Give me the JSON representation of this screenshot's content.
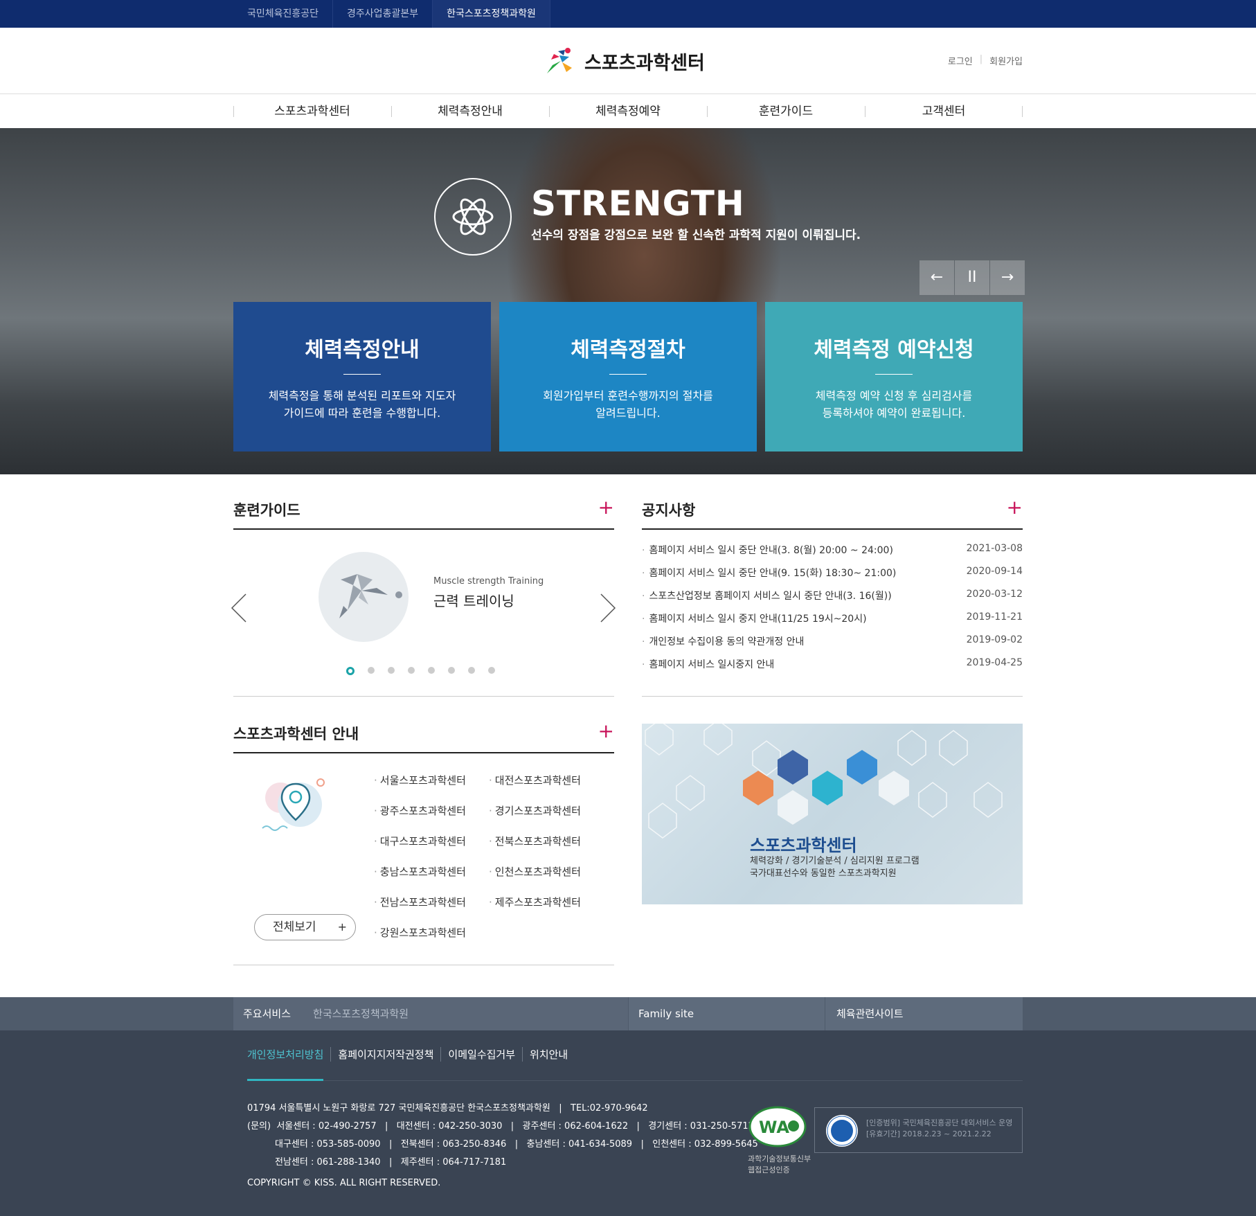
{
  "topbar": {
    "tabs": [
      "국민체육진흥공단",
      "경주사업총괄본부",
      "한국스포츠정책과학원"
    ]
  },
  "logo": {
    "text": "스포츠과학센터"
  },
  "util": {
    "login": "로그인",
    "join": "회원가입"
  },
  "gnb": [
    "스포츠과학센터",
    "체력측정안내",
    "체력측정예약",
    "훈련가이드",
    "고객센터"
  ],
  "hero": {
    "title": "STRENGTH",
    "subtitle": "선수의 장점을 강점으로 보완 할 신속한 과학적 지원이 이뤄집니다.",
    "controls": {
      "prev": "←",
      "pause": "II",
      "next": "→"
    },
    "boxes": [
      {
        "title": "체력측정안내",
        "desc1": "체력측정을 통해 분석된 리포트와 지도자",
        "desc2": "가이드에 따라 훈련을 수행합니다.",
        "color": "#1f4b8f"
      },
      {
        "title": "체력측정절차",
        "desc1": "회원가입부터 훈련수행까지의 절차를",
        "desc2": "알려드립니다.",
        "color": "#1d86c4"
      },
      {
        "title": "체력측정 예약신청",
        "desc1": "체력측정 예약 신청 후 심리검사를",
        "desc2": "등록하셔야 예약이 완료됩니다.",
        "color": "#3fa9b6"
      }
    ]
  },
  "guide": {
    "title": "훈련가이드",
    "plus": "+",
    "en": "Muscle strength Training",
    "ko": "근력 트레이닝",
    "dots": 8,
    "active_dot": 1
  },
  "notice": {
    "title": "공지사항",
    "plus": "+",
    "items": [
      {
        "title": "홈페이지 서비스 일시 중단 안내(3. 8(월) 20:00 ~ 24:00)",
        "date": "2021-03-08"
      },
      {
        "title": "홈페이지 서비스 일시 중단 안내(9. 15(화) 18:30~ 21:00)",
        "date": "2020-09-14"
      },
      {
        "title": "스포츠산업정보 홈페이지 서비스 일시 중단 안내(3. 16(월))",
        "date": "2020-03-12"
      },
      {
        "title": "홈페이지 서비스 일시 중지 안내(11/25 19시~20시)",
        "date": "2019-11-21"
      },
      {
        "title": "개인정보 수집이용 동의 약관개정 안내",
        "date": "2019-09-02"
      },
      {
        "title": "홈페이지 서비스 일시중지 안내",
        "date": "2019-04-25"
      }
    ]
  },
  "centers": {
    "title": "스포츠과학센터 안내",
    "plus": "+",
    "items": [
      "서울스포츠과학센터",
      "대전스포츠과학센터",
      "광주스포츠과학센터",
      "경기스포츠과학센터",
      "대구스포츠과학센터",
      "전북스포츠과학센터",
      "충남스포츠과학센터",
      "인천스포츠과학센터",
      "전남스포츠과학센터",
      "제주스포츠과학센터",
      "강원스포츠과학센터"
    ],
    "all_button": "전체보기",
    "all_plus": "+"
  },
  "banner": {
    "title": "스포츠과학센터",
    "line1": "체력강화 / 경기기술분석 / 심리지원 프로그램",
    "line2": "국가대표선수와 동일한 스포츠과학지원"
  },
  "footer_service": {
    "main_label": "주요서비스",
    "main_site": "한국스포츠정책과학원",
    "family": "Family site",
    "related": "체육관련사이트"
  },
  "footer": {
    "links": [
      "개인정보처리방침",
      "홈페이지지저작권정책",
      "이메일수집거부",
      "위치안내"
    ],
    "address": "01794 서울특별시 노원구 화랑로 727 국민체육진흥공단 한국스포츠정책과학원",
    "tel": "TEL:02-970-9642",
    "contact1": "(문의)  서울센터 : 02-490-2757   |   대전센터 : 042-250-3030   |   광주센터 : 062-604-1622   |   경기센터 : 031-250-5712",
    "contact2": "대구센터 : 053-585-0090   |   전북센터 : 063-250-8346   |   충남센터 : 041-634-5089   |   인천센터 : 032-899-5645",
    "contact3": "전남센터 : 061-288-1340   |   제주센터 : 064-717-7181",
    "copyright": "COPYRIGHT © KISS. ALL RIGHT RESERVED.",
    "wa_line1": "과학기술정보통신부",
    "wa_line2": "웹접근성인증",
    "isms_line1": "[인증범위] 국민체육진흥공단 대외서비스 운영",
    "isms_line2": "[유효기간] 2018.2.23 ~ 2021.2.22"
  }
}
